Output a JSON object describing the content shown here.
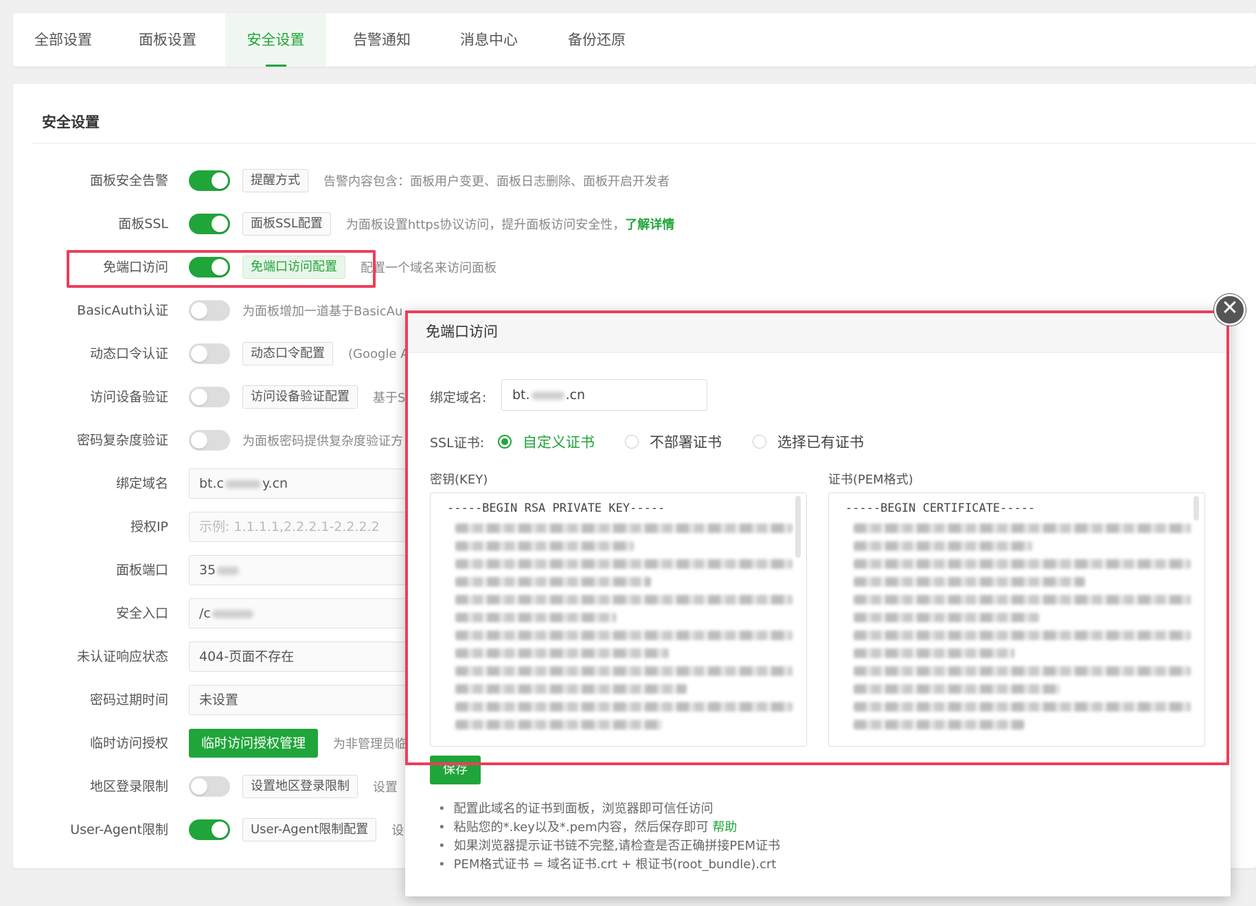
{
  "tabs": [
    "全部设置",
    "面板设置",
    "安全设置",
    "告警通知",
    "消息中心",
    "备份还原"
  ],
  "panel_title": "安全设置",
  "rows": {
    "alert": {
      "label": "面板安全告警",
      "switch_on": true,
      "button": "提醒方式",
      "desc": "告警内容包含：面板用户变更、面板日志删除、面板开启开发者"
    },
    "ssl": {
      "label": "面板SSL",
      "switch_on": true,
      "button": "面板SSL配置",
      "desc": "为面板设置https协议访问，提升面板访问安全性，",
      "link": "了解详情"
    },
    "noport": {
      "label": "免端口访问",
      "switch_on": true,
      "button": "免端口访问配置",
      "desc": "配置一个域名来访问面板"
    },
    "basicauth": {
      "label": "BasicAuth认证",
      "switch_on": false,
      "desc": "为面板增加一道基于BasicAu"
    },
    "dynamic": {
      "label": "动态口令认证",
      "switch_on": false,
      "button": "动态口令配置",
      "desc": "(Google A"
    },
    "device": {
      "label": "访问设备验证",
      "switch_on": false,
      "button": "访问设备验证配置",
      "desc": "基于S"
    },
    "pwd": {
      "label": "密码复杂度验证",
      "switch_on": false,
      "desc": "为面板密码提供复杂度验证方"
    },
    "domain": {
      "label": "绑定域名",
      "value_prefix": "bt.c",
      "value_suffix": "y.cn"
    },
    "ip": {
      "label": "授权IP",
      "placeholder": "示例: 1.1.1.1,2.2.2.1-2.2.2.2"
    },
    "port": {
      "label": "面板端口",
      "value_prefix": "35"
    },
    "entry": {
      "label": "安全入口",
      "value_prefix": "/c"
    },
    "unauth": {
      "label": "未认证响应状态",
      "value": "404-页面不存在"
    },
    "expire": {
      "label": "密码过期时间",
      "value": "未设置"
    },
    "temp": {
      "label": "临时访问授权",
      "button": "临时访问授权管理",
      "desc": "为非管理员临"
    },
    "region": {
      "label": "地区登录限制",
      "switch_on": false,
      "button": "设置地区登录限制",
      "desc": "设置"
    },
    "ua": {
      "label": "User-Agent限制",
      "switch_on": true,
      "button": "User-Agent限制配置",
      "desc": "设"
    }
  },
  "modal": {
    "title": "免端口访问",
    "domain_label": "绑定域名:",
    "domain_prefix": "bt.",
    "domain_suffix": ".cn",
    "ssl_label": "SSL证书:",
    "radios": [
      "自定义证书",
      "不部署证书",
      "选择已有证书"
    ],
    "selected_radio": "自定义证书",
    "key_label": "密钥(KEY)",
    "key_first_line": "-----BEGIN RSA PRIVATE KEY-----",
    "cert_label": "证书(PEM格式)",
    "cert_first_line": "-----BEGIN CERTIFICATE-----",
    "save": "保存",
    "tips": [
      "配置此域名的证书到面板，浏览器即可信任访问",
      "粘贴您的*.key以及*.pem内容，然后保存即可",
      "如果浏览器提示证书链不完整,请检查是否正确拼接PEM证书",
      "PEM格式证书 = 域名证书.crt + 根证书(root_bundle).crt"
    ],
    "help_link": "帮助"
  },
  "colors": {
    "accent": "#20a53a",
    "highlight": "#ee3d5a"
  }
}
